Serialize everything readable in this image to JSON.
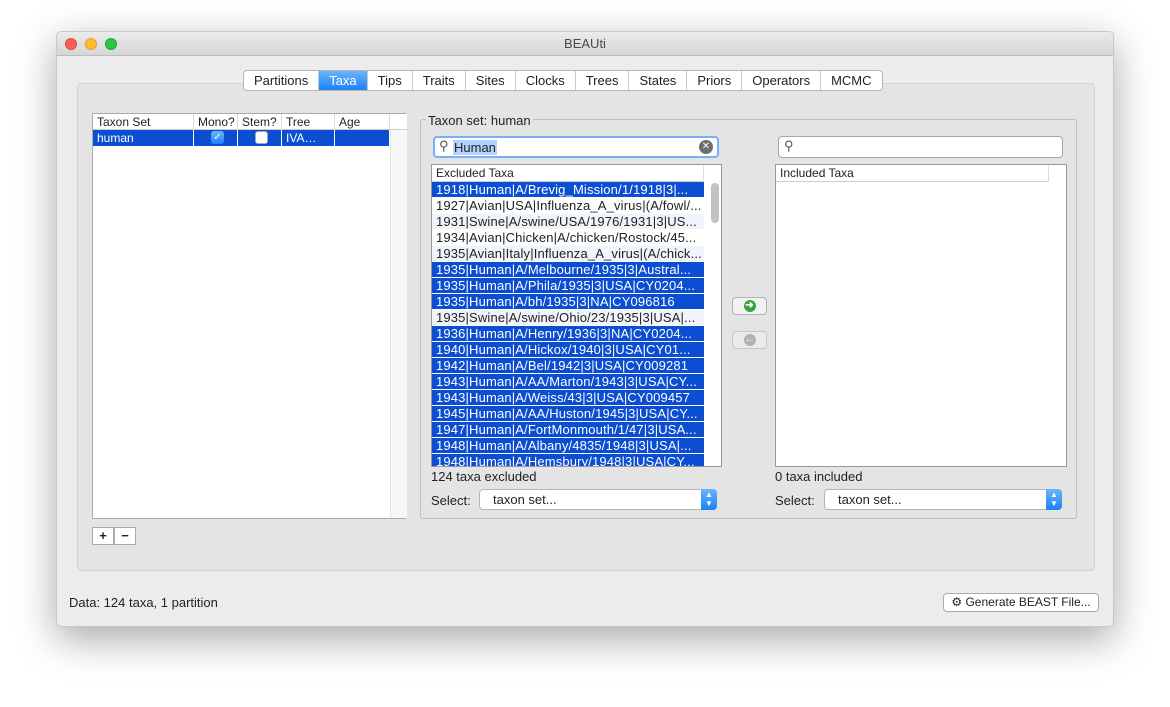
{
  "window": {
    "title": "BEAUti"
  },
  "tabs": [
    {
      "label": "Partitions"
    },
    {
      "label": "Taxa",
      "selected": true
    },
    {
      "label": "Tips"
    },
    {
      "label": "Traits"
    },
    {
      "label": "Sites"
    },
    {
      "label": "Clocks"
    },
    {
      "label": "Trees"
    },
    {
      "label": "States"
    },
    {
      "label": "Priors"
    },
    {
      "label": "Operators"
    },
    {
      "label": "MCMC"
    }
  ],
  "taxon_sets": {
    "columns": [
      "Taxon Set",
      "Mono?",
      "Stem?",
      "Tree",
      "Age"
    ],
    "rows": [
      {
        "name": "human",
        "mono": true,
        "stem": false,
        "tree": "IVA…",
        "age": ""
      }
    ],
    "add_label": "+",
    "remove_label": "−"
  },
  "taxon_panel": {
    "title": "Taxon set: human",
    "excluded": {
      "search_value": "Human",
      "header": "Excluded Taxa",
      "count": "124 taxa excluded",
      "select_label": "Select:",
      "select_value": "taxon set...",
      "rows": [
        {
          "text": "1918|Human|A/Brevig_Mission/1/1918|3|...",
          "selected": true
        },
        {
          "text": "1927|Avian|USA|Influenza_A_virus|(A/fowl/...",
          "selected": false
        },
        {
          "text": "1931|Swine|A/swine/USA/1976/1931|3|US...",
          "selected": false
        },
        {
          "text": "1934|Avian|Chicken|A/chicken/Rostock/45...",
          "selected": false
        },
        {
          "text": "1935|Avian|Italy|Influenza_A_virus|(A/chick...",
          "selected": false
        },
        {
          "text": "1935|Human|A/Melbourne/1935|3|Austral...",
          "selected": true
        },
        {
          "text": "1935|Human|A/Phila/1935|3|USA|CY0204...",
          "selected": true
        },
        {
          "text": "1935|Human|A/bh/1935|3|NA|CY096816",
          "selected": true
        },
        {
          "text": "1935|Swine|A/swine/Ohio/23/1935|3|USA|...",
          "selected": false
        },
        {
          "text": "1936|Human|A/Henry/1936|3|NA|CY0204...",
          "selected": true
        },
        {
          "text": "1940|Human|A/Hickox/1940|3|USA|CY01...",
          "selected": true
        },
        {
          "text": "1942|Human|A/Bel/1942|3|USA|CY009281",
          "selected": true
        },
        {
          "text": "1943|Human|A/AA/Marton/1943|3|USA|CY...",
          "selected": true
        },
        {
          "text": "1943|Human|A/Weiss/43|3|USA|CY009457",
          "selected": true
        },
        {
          "text": "1945|Human|A/AA/Huston/1945|3|USA|CY...",
          "selected": true
        },
        {
          "text": "1947|Human|A/FortMonmouth/1/47|3|USA...",
          "selected": true
        },
        {
          "text": "1948|Human|A/Albany/4835/1948|3|USA|...",
          "selected": true
        },
        {
          "text": "1948|Human|A/Hemsbury/1948|3|USA|CY...",
          "selected": true
        }
      ]
    },
    "included": {
      "search_value": "",
      "header": "Included Taxa",
      "count": "0 taxa included",
      "select_label": "Select:",
      "select_value": "taxon set..."
    }
  },
  "status": {
    "text": "Data: 124 taxa, 1 partition",
    "generate_label": "Generate BEAST File..."
  },
  "colors": {
    "selection": "#0b4ed1",
    "accent": "#1a82fb",
    "include_arrow": "#3aa33a"
  }
}
